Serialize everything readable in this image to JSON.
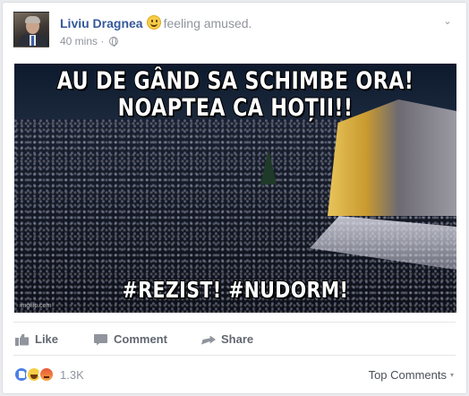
{
  "post": {
    "author": "Liviu Dragnea",
    "feeling": "feeling amused.",
    "timestamp": "40 mins",
    "separator": "·",
    "privacy_icon": "globe-icon",
    "menu_icon": "chevron-down-icon"
  },
  "photo": {
    "line1": "AU DE GÂND SA SCHIMBE ORA!",
    "line2": "NOAPTEA CA HOȚII!!",
    "line3": "#REZIST! #NUDORM!",
    "credit": "imgflip.com"
  },
  "actions": {
    "like": "Like",
    "comment": "Comment",
    "share": "Share"
  },
  "reactions": {
    "types": [
      "like-icon",
      "haha-icon",
      "angry-icon"
    ],
    "count": "1.3K"
  },
  "comments": {
    "sort_label": "Top Comments",
    "sort_caret": "▾"
  },
  "colors": {
    "author_link": "#365899",
    "muted_text": "#90949c",
    "like_blue": "#4a7fe8"
  }
}
